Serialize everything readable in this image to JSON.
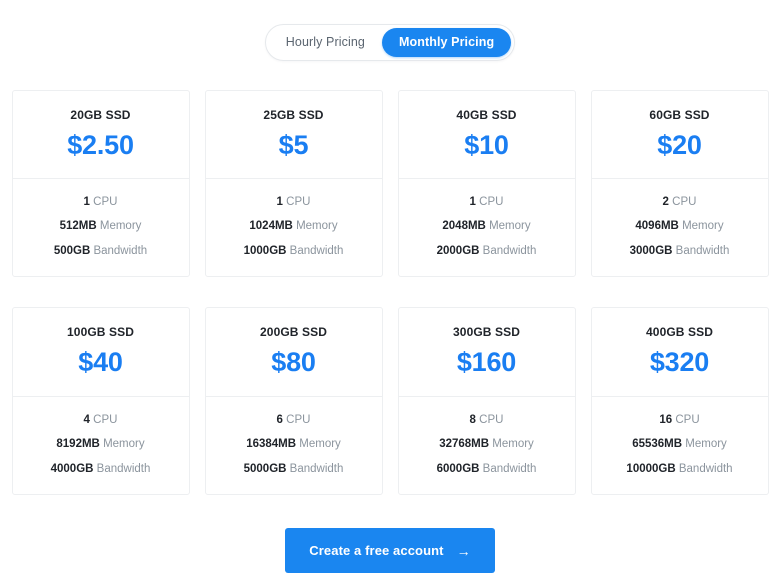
{
  "toggle": {
    "options": [
      {
        "label": "Hourly Pricing",
        "active": false
      },
      {
        "label": "Monthly Pricing",
        "active": true
      }
    ]
  },
  "colors": {
    "accent": "#1a86f0",
    "price": "#1a7ef2",
    "card_border": "#edeff1",
    "spec_label": "#8b949d",
    "text_dark": "#20242a",
    "background": "#ffffff"
  },
  "plans": [
    {
      "title": "20GB SSD",
      "price": "$2.50",
      "cpu_value": "1",
      "cpu_label": "CPU",
      "memory_value": "512MB",
      "memory_label": "Memory",
      "bandwidth_value": "500GB",
      "bandwidth_label": "Bandwidth"
    },
    {
      "title": "25GB SSD",
      "price": "$5",
      "cpu_value": "1",
      "cpu_label": "CPU",
      "memory_value": "1024MB",
      "memory_label": "Memory",
      "bandwidth_value": "1000GB",
      "bandwidth_label": "Bandwidth"
    },
    {
      "title": "40GB SSD",
      "price": "$10",
      "cpu_value": "1",
      "cpu_label": "CPU",
      "memory_value": "2048MB",
      "memory_label": "Memory",
      "bandwidth_value": "2000GB",
      "bandwidth_label": "Bandwidth"
    },
    {
      "title": "60GB SSD",
      "price": "$20",
      "cpu_value": "2",
      "cpu_label": "CPU",
      "memory_value": "4096MB",
      "memory_label": "Memory",
      "bandwidth_value": "3000GB",
      "bandwidth_label": "Bandwidth"
    },
    {
      "title": "100GB SSD",
      "price": "$40",
      "cpu_value": "4",
      "cpu_label": "CPU",
      "memory_value": "8192MB",
      "memory_label": "Memory",
      "bandwidth_value": "4000GB",
      "bandwidth_label": "Bandwidth"
    },
    {
      "title": "200GB SSD",
      "price": "$80",
      "cpu_value": "6",
      "cpu_label": "CPU",
      "memory_value": "16384MB",
      "memory_label": "Memory",
      "bandwidth_value": "5000GB",
      "bandwidth_label": "Bandwidth"
    },
    {
      "title": "300GB SSD",
      "price": "$160",
      "cpu_value": "8",
      "cpu_label": "CPU",
      "memory_value": "32768MB",
      "memory_label": "Memory",
      "bandwidth_value": "6000GB",
      "bandwidth_label": "Bandwidth"
    },
    {
      "title": "400GB SSD",
      "price": "$320",
      "cpu_value": "16",
      "cpu_label": "CPU",
      "memory_value": "65536MB",
      "memory_label": "Memory",
      "bandwidth_value": "10000GB",
      "bandwidth_label": "Bandwidth"
    }
  ],
  "cta": {
    "label": "Create a free account",
    "arrow_icon": "arrow-right-icon",
    "arrow_glyph": "→"
  }
}
